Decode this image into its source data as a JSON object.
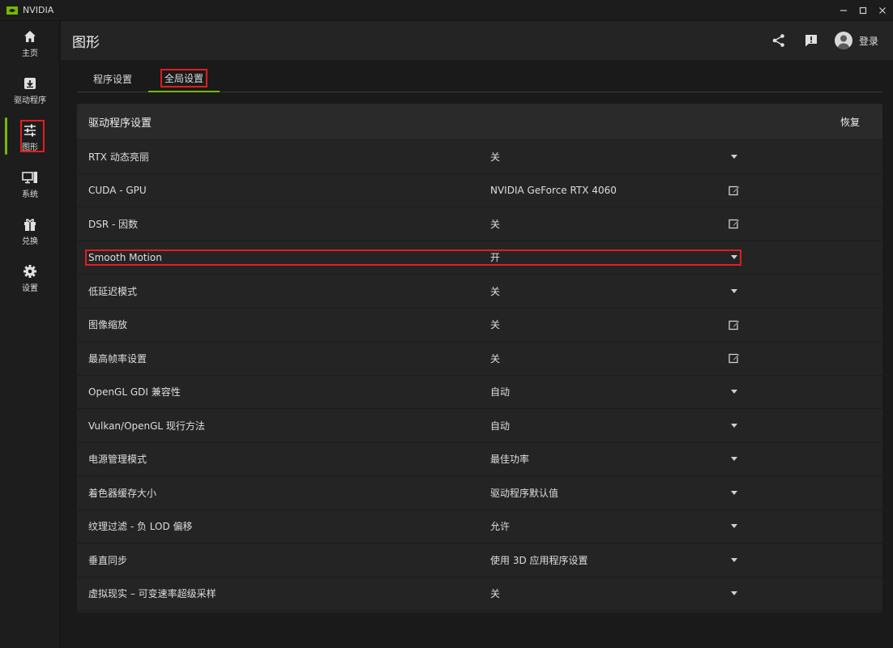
{
  "window": {
    "title": "NVIDIA",
    "controls": [
      "minimize-icon",
      "maximize-icon",
      "close-icon"
    ]
  },
  "sidebar": {
    "items": [
      {
        "label": "主页",
        "icon": "home-icon"
      },
      {
        "label": "驱动程序",
        "icon": "driver-download-icon"
      },
      {
        "label": "图形",
        "icon": "sliders-icon",
        "active": true
      },
      {
        "label": "系统",
        "icon": "monitor-icon"
      },
      {
        "label": "兑换",
        "icon": "gift-icon"
      },
      {
        "label": "设置",
        "icon": "gear-icon"
      }
    ]
  },
  "header": {
    "title": "图形",
    "login_label": "登录"
  },
  "tabs": [
    {
      "label": "程序设置"
    },
    {
      "label": "全局设置",
      "active": true
    }
  ],
  "panel": {
    "title": "驱动程序设置",
    "restore_label": "恢复",
    "rows": [
      {
        "label": "RTX 动态亮丽",
        "value": "关",
        "control": "dropdown"
      },
      {
        "label": "CUDA - GPU",
        "value": "NVIDIA GeForce RTX 4060",
        "control": "edit"
      },
      {
        "label": "DSR - 因数",
        "value": "关",
        "control": "edit"
      },
      {
        "label": "Smooth Motion",
        "value": "开",
        "control": "dropdown",
        "highlighted": true
      },
      {
        "label": "低延迟模式",
        "value": "关",
        "control": "dropdown"
      },
      {
        "label": "图像缩放",
        "value": "关",
        "control": "edit"
      },
      {
        "label": "最高帧率设置",
        "value": "关",
        "control": "edit"
      },
      {
        "label": "OpenGL GDI 兼容性",
        "value": "自动",
        "control": "dropdown"
      },
      {
        "label": "Vulkan/OpenGL 现行方法",
        "value": "自动",
        "control": "dropdown"
      },
      {
        "label": "电源管理模式",
        "value": "最佳功率",
        "control": "dropdown"
      },
      {
        "label": "着色器缓存大小",
        "value": "驱动程序默认值",
        "control": "dropdown"
      },
      {
        "label": "纹理过滤 - 负 LOD 偏移",
        "value": "允许",
        "control": "dropdown"
      },
      {
        "label": "垂直同步",
        "value": "使用 3D 应用程序设置",
        "control": "dropdown"
      },
      {
        "label": "虚拟现实 – 可变速率超级采样",
        "value": "关",
        "control": "dropdown"
      }
    ]
  },
  "colors": {
    "accent": "#76b900",
    "highlight": "#e01e1e"
  }
}
